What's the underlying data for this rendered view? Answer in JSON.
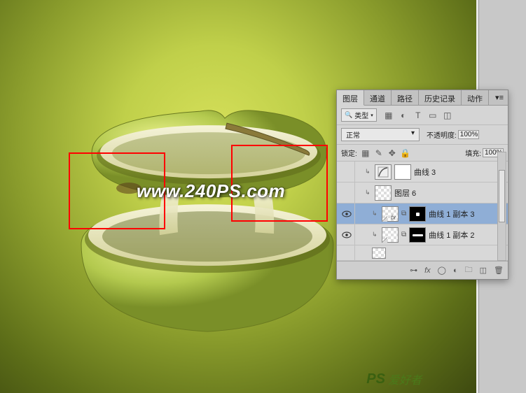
{
  "watermarks": {
    "center": "www.240PS.com",
    "corner_logo": "PS",
    "corner_text": "爱好者"
  },
  "panel": {
    "tabs": [
      "图层",
      "通道",
      "路径",
      "历史记录",
      "动作"
    ],
    "active_tab": 0,
    "kind_label": "类型",
    "blend_mode": "正常",
    "opacity_label": "不透明度:",
    "opacity_value": "100%",
    "lock_label": "锁定:",
    "fill_label": "填充:",
    "fill_value": "100%",
    "filter_icons": [
      "image-icon",
      "adjust-icon",
      "type-icon",
      "shape-icon",
      "smart-icon"
    ],
    "colors": {
      "selection_bg": "#8faed6",
      "panel_bg": "#d5d5d5"
    }
  },
  "layers": [
    {
      "visible": false,
      "clip": true,
      "indent": 1,
      "thumbs": [
        "adj",
        "mask-white"
      ],
      "name": "曲线 3",
      "selected": false
    },
    {
      "visible": false,
      "clip": true,
      "indent": 1,
      "thumbs": [
        "trans"
      ],
      "name": "图层 6",
      "selected": false
    },
    {
      "visible": true,
      "clip": true,
      "indent": 2,
      "thumbs": [
        "trans-fx",
        "link",
        "mask"
      ],
      "name": "曲线 1 副本 3",
      "selected": true
    },
    {
      "visible": true,
      "clip": true,
      "indent": 2,
      "thumbs": [
        "trans",
        "link",
        "mask-long"
      ],
      "name": "曲线 1 副本 2",
      "selected": false
    },
    {
      "visible": false,
      "clip": false,
      "indent": 2,
      "thumbs": [
        "trans"
      ],
      "name": "",
      "selected": false
    }
  ],
  "footer_icons": [
    "link",
    "fx",
    "mask",
    "adjust",
    "group",
    "new",
    "trash"
  ]
}
